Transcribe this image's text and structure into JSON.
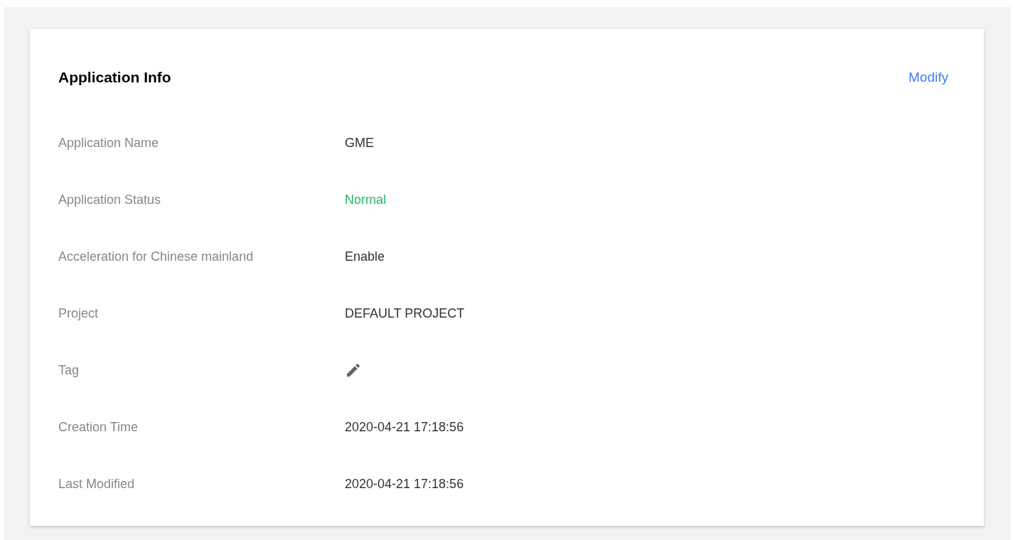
{
  "card": {
    "title": "Application Info",
    "action": "Modify"
  },
  "fields": [
    {
      "label": "Application Name",
      "kind": "text",
      "value": "GME"
    },
    {
      "label": "Application Status",
      "kind": "status",
      "value": "Normal"
    },
    {
      "label": "Acceleration for Chinese mainland",
      "kind": "text",
      "value": "Enable"
    },
    {
      "label": "Project",
      "kind": "text",
      "value": "DEFAULT PROJECT"
    },
    {
      "label": "Tag",
      "kind": "edit"
    },
    {
      "label": "Creation Time",
      "kind": "text",
      "value": "2020-04-21 17:18:56"
    },
    {
      "label": "Last Modified",
      "kind": "text",
      "value": "2020-04-21 17:18:56"
    }
  ]
}
